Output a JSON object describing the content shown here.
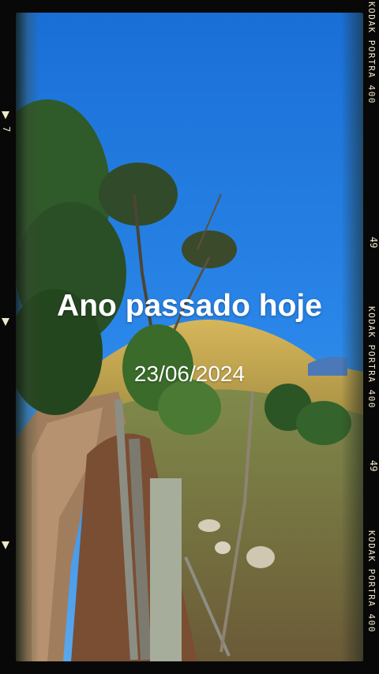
{
  "overlay": {
    "title": "Ano passado hoje",
    "date": "23/06/2024"
  },
  "film_strip": {
    "brand_label": "KODAK PORTRA 400",
    "frame_numbers": [
      "49",
      "49"
    ],
    "left_marker": "7"
  },
  "colors": {
    "sky": "#1f7fe0",
    "hill": "#c9a74a",
    "dirt_road": "#9c7a5a",
    "frame": "#080808",
    "film_text": "#f1e6c8"
  },
  "icons": {
    "frame_marker": "triangle-arrow-icon"
  }
}
